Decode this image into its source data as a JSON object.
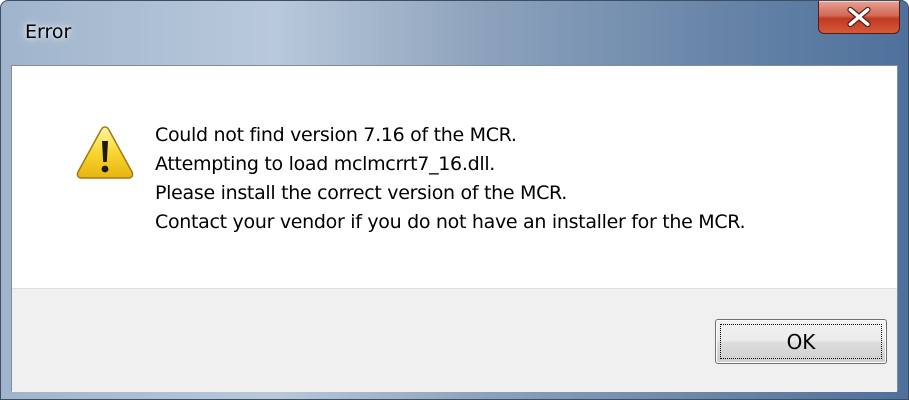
{
  "window": {
    "title": "Error",
    "close_icon": "close-x-icon",
    "close_button_color": "#c7402a"
  },
  "message": {
    "icon": "warning-triangle-icon",
    "lines": [
      "Could not find version 7.16 of the MCR.",
      "Attempting to load mclmcrrt7_16.dll.",
      "Please install the correct version of the MCR.",
      "Contact your vendor if you do not have an installer for the MCR."
    ]
  },
  "buttons": {
    "ok_label": "OK"
  }
}
